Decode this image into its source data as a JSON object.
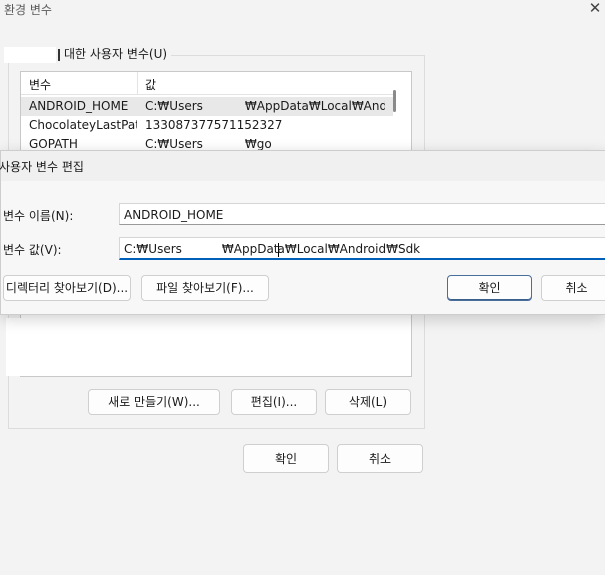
{
  "window": {
    "title": "환경 변수",
    "close_glyph": "✕"
  },
  "user_vars": {
    "group_title": "대한 사용자 변수(U)",
    "columns": [
      "변수",
      "값"
    ],
    "rows": [
      {
        "name": "ANDROID_HOME",
        "value_prefix": "C:₩Users",
        "value_suffix": "₩AppData₩Local₩Androi..."
      },
      {
        "name": "ChocolateyLastPat...",
        "value_prefix": "133087377571152327",
        "value_suffix": ""
      },
      {
        "name": "GOPATH",
        "value_prefix": "C:₩Users",
        "value_suffix": "₩go"
      }
    ],
    "buttons": {
      "new": "새로 만들기(W)...",
      "edit": "편집(I)...",
      "delete": "삭제(L)"
    }
  },
  "main_buttons": {
    "ok": "확인",
    "cancel": "취소"
  },
  "edit_dialog": {
    "title": "사용자 변수 편집",
    "name_label": "변수 이름(N):",
    "name_value": "ANDROID_HOME",
    "value_label": "변수 값(V):",
    "value_prefix": "C:₩Users",
    "value_mid": "₩AppDat",
    "value_after_caret": "a₩Local₩Android₩Sdk",
    "browse_dir": "디렉터리 찾아보기(D)...",
    "browse_file": "파일 찾아보기(F)...",
    "ok": "확인",
    "cancel": "취소"
  }
}
